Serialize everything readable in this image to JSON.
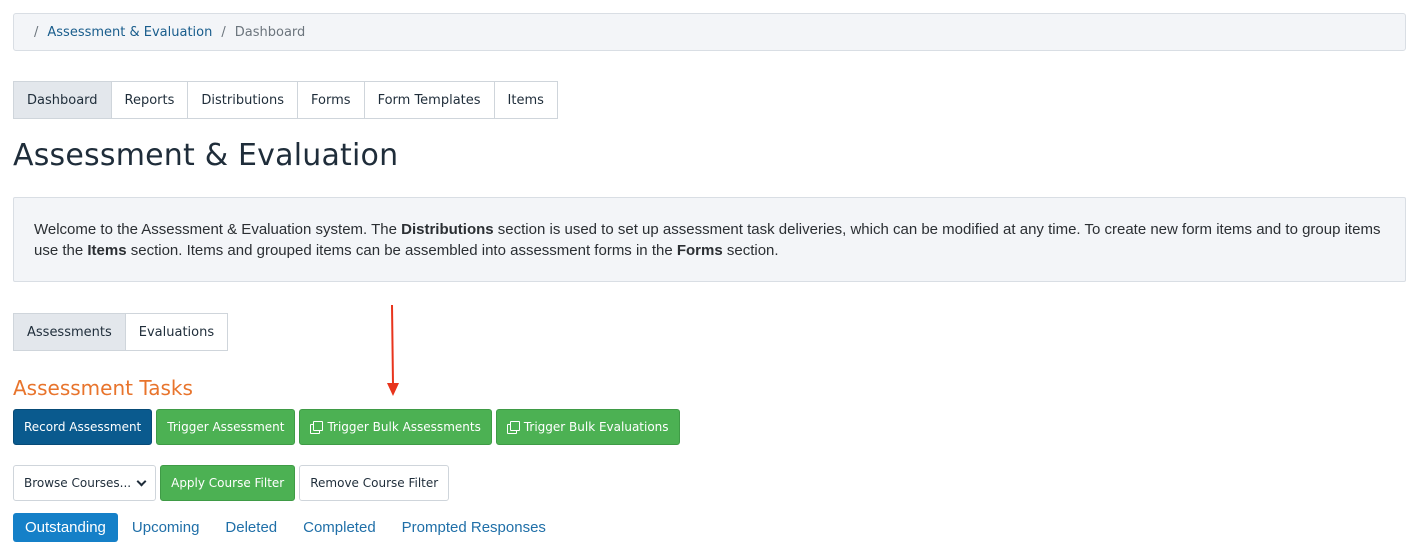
{
  "breadcrumb": {
    "separator": "/",
    "items": [
      "Assessment & Evaluation",
      "Dashboard"
    ]
  },
  "main_tabs": [
    "Dashboard",
    "Reports",
    "Distributions",
    "Forms",
    "Form Templates",
    "Items"
  ],
  "page_title": "Assessment & Evaluation",
  "info": {
    "p1": "Welcome to the Assessment & Evaluation system. The ",
    "b1": "Distributions",
    "p2": " section is used to set up assessment task deliveries, which can be modified at any time. To create new form items and to group items use the ",
    "b2": "Items",
    "p3": " section. Items and grouped items can be assembled into assessment forms in the ",
    "b3": "Forms",
    "p4": " section."
  },
  "sub_tabs": [
    "Assessments",
    "Evaluations"
  ],
  "section_title": "Assessment Tasks",
  "actions": {
    "record": "Record Assessment",
    "trigger": "Trigger Assessment",
    "bulk_assess": "Trigger Bulk Assessments",
    "bulk_eval": "Trigger Bulk Evaluations"
  },
  "filters": {
    "browse": "Browse Courses...",
    "apply": "Apply Course Filter",
    "remove": "Remove Course Filter"
  },
  "status_tabs": [
    "Outstanding",
    "Upcoming",
    "Deleted",
    "Completed",
    "Prompted Responses"
  ],
  "colors": {
    "accent_orange": "#e8742c",
    "primary_blue": "#0a5a8e",
    "success_green": "#4cb153",
    "link_blue": "#1f6fa8",
    "annotation_red": "#e8341c"
  }
}
